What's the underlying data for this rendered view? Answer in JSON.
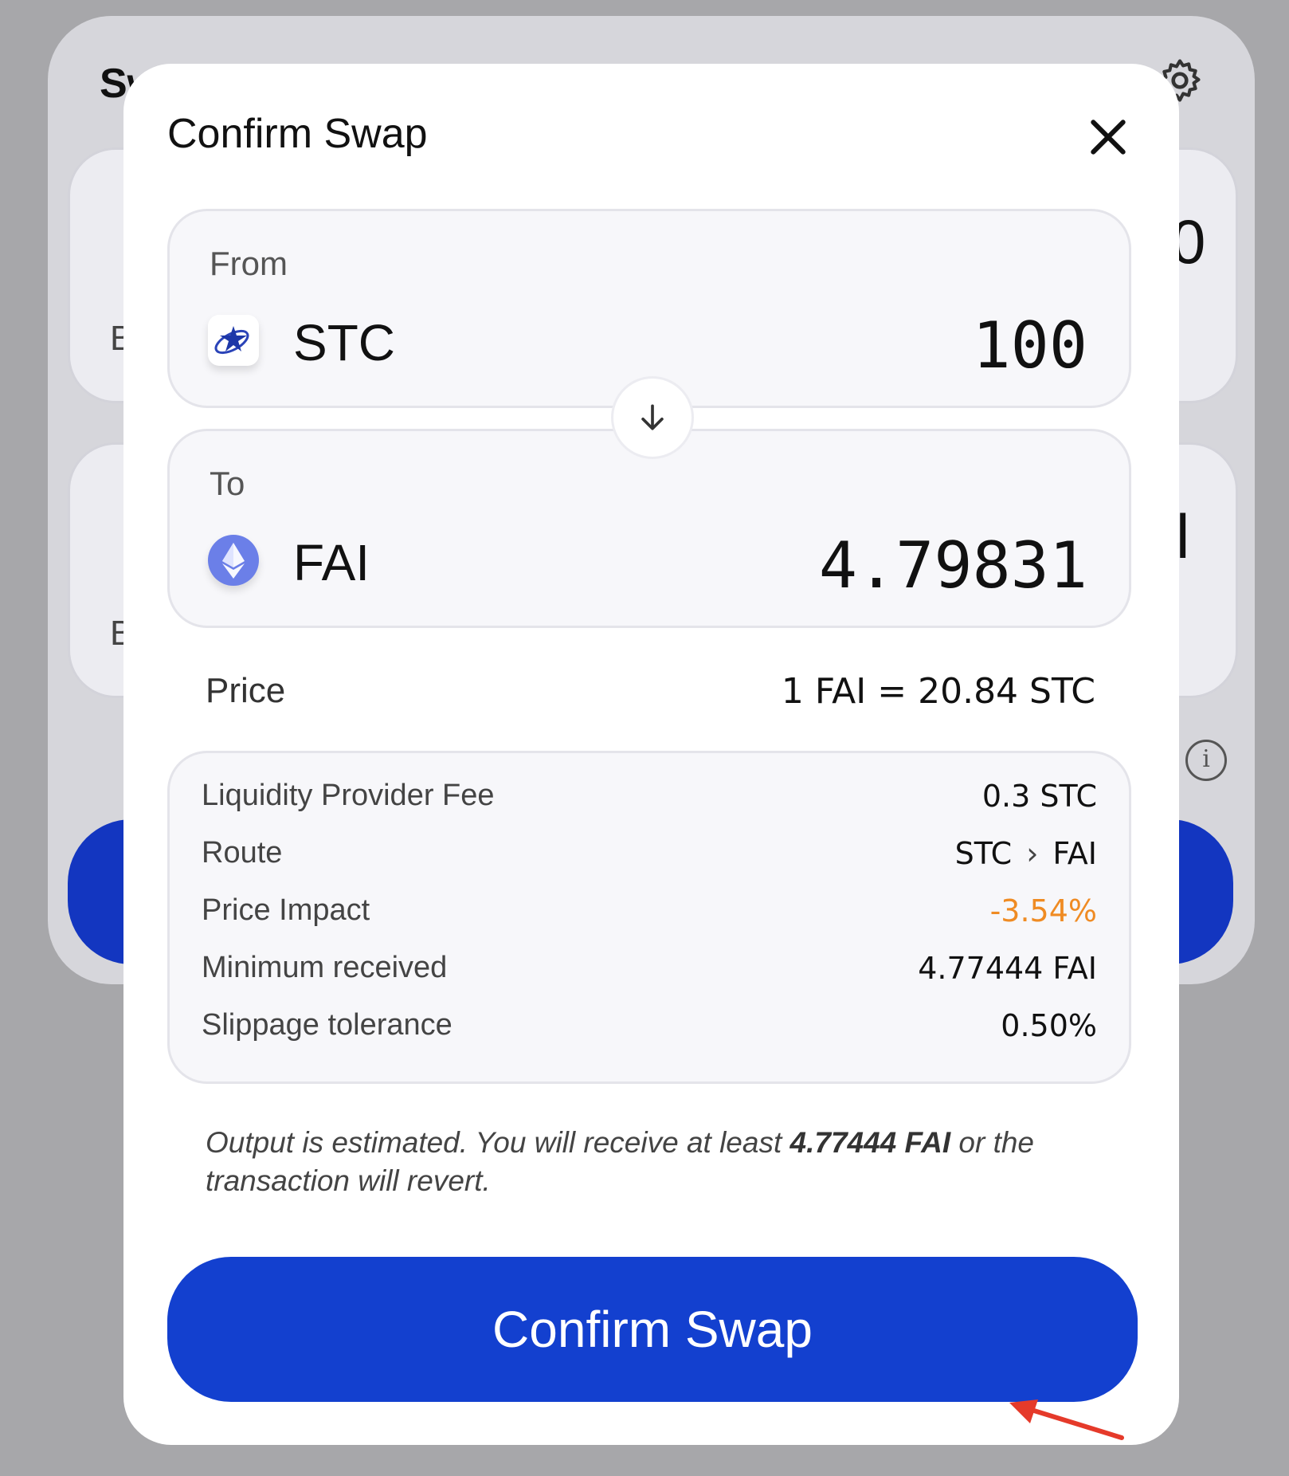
{
  "background": {
    "title_fragment": "Sw",
    "panel1_fragment": "B",
    "panel2_fragment": "B",
    "panel1_amount_fragment": "0",
    "panel2_amount_fragment": "l"
  },
  "modal": {
    "title": "Confirm Swap",
    "from": {
      "label": "From",
      "symbol": "STC",
      "amount": "100",
      "logo": "starcoin-logo"
    },
    "to": {
      "label": "To",
      "symbol": "FAI",
      "amount": "4.79831",
      "logo": "eth-diamond-logo"
    },
    "price": {
      "label": "Price",
      "value": "1 FAI = 20.84 STC"
    },
    "details": {
      "lp_fee": {
        "label": "Liquidity Provider Fee",
        "value": "0.3 STC"
      },
      "route": {
        "label": "Route",
        "from": "STC",
        "to": "FAI"
      },
      "price_impact": {
        "label": "Price Impact",
        "value": "-3.54%"
      },
      "min_received": {
        "label": "Minimum received",
        "value": "4.77444 FAI"
      },
      "slippage": {
        "label": "Slippage tolerance",
        "value": "0.50%"
      }
    },
    "note": {
      "prefix": "Output is estimated. You will receive at least ",
      "amount": "4.77444 FAI",
      "suffix": " or the transaction will revert."
    },
    "confirm_label": "Confirm Swap"
  },
  "colors": {
    "accent": "#1340cf",
    "warning": "#ef8b23",
    "overlay": "#a7a7aa"
  }
}
